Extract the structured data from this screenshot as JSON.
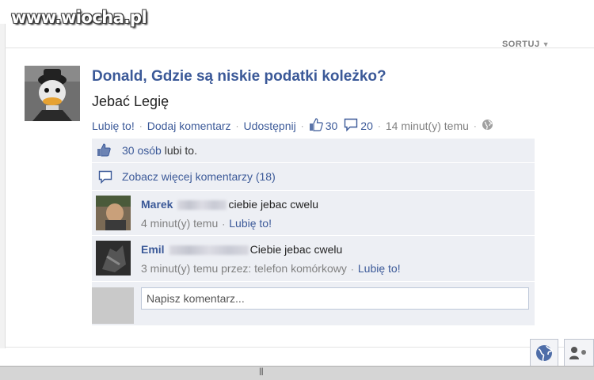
{
  "watermark": {
    "text": "www.wiocha.pl"
  },
  "feed": {
    "sort_label": "SORTUJ"
  },
  "post": {
    "title": "Donald, Gdzie są niskie podatki koleżko?",
    "text": "Jebać Legię",
    "actions": {
      "like": "Lubię to!",
      "comment": "Dodaj komentarz",
      "share": "Udostępnij",
      "likes_count": "30",
      "comments_count": "20",
      "time": "14 minut(y) temu"
    }
  },
  "ufi": {
    "likes_link": "30 osób",
    "likes_suffix": "lubi to.",
    "more_comments": "Zobacz więcej komentarzy (18)",
    "comments": [
      {
        "author": "Marek",
        "text": "ciebie jebac cwelu",
        "time": "4 minut(y) temu",
        "like": "Lubię to!"
      },
      {
        "author": "Emil",
        "text": "Ciebie jebac cwelu",
        "time": "3 minut(y) temu przez: telefon komórkowy",
        "like": "Lubię to!"
      }
    ],
    "composer_placeholder": "Napisz komentarz..."
  },
  "colors": {
    "link": "#3b5998",
    "ufi_bg": "#edeff4",
    "meta": "#808080"
  },
  "icons": [
    "thumbs-up-icon",
    "speech-bubble-icon",
    "globe-icon",
    "chevron-down-icon",
    "friends-icon",
    "grip-icon"
  ]
}
